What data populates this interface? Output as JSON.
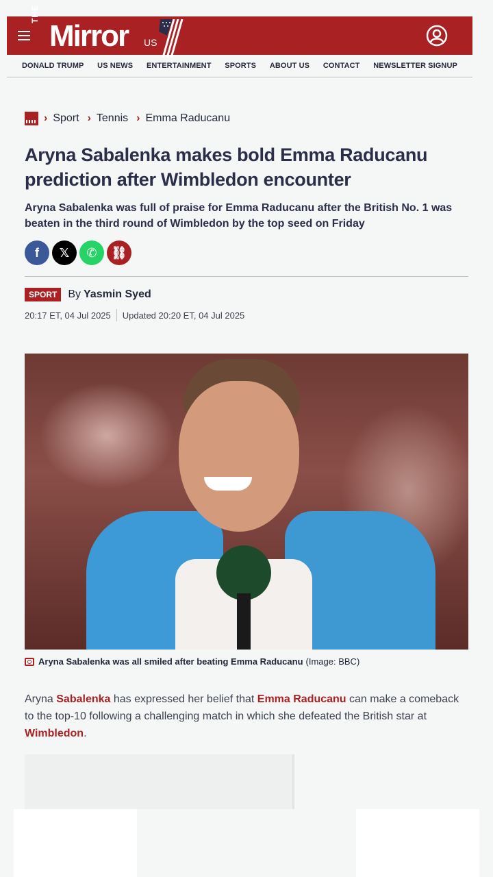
{
  "header": {
    "logo_the": "THE",
    "logo_mirror": "Mirror",
    "logo_us": "US",
    "brand_color": "#aa2124"
  },
  "nav": {
    "items": [
      "DONALD TRUMP",
      "US NEWS",
      "ENTERTAINMENT",
      "SPORTS",
      "ABOUT US",
      "CONTACT",
      "NEWSLETTER SIGNUP"
    ]
  },
  "breadcrumb": {
    "items": [
      "Sport",
      "Tennis",
      "Emma Raducanu"
    ]
  },
  "article": {
    "headline": "Aryna Sabalenka makes bold Emma Raducanu prediction after Wimbledon encounter",
    "standfirst": "Aryna Sabalenka was full of praise for Emma Raducanu after the British No. 1 was beaten in the third round of Wimbledon by the top seed on Friday",
    "section_badge": "SPORT",
    "by_label": "By",
    "author": "Yasmin Syed",
    "published": "20:17 ET, 04 Jul 2025",
    "updated": "Updated 20:20 ET, 04 Jul 2025",
    "image_caption": "Aryna Sabalenka was all smiled after beating Emma Raducanu",
    "image_credit": "(Image: BBC)",
    "body": {
      "p1_a": "Aryna ",
      "p1_link1": "Sabalenka",
      "p1_b": " has expressed her belief that ",
      "p1_link2": "Emma Raducanu",
      "p1_c": " can make a comeback to the top-10 following a challenging match in which she defeated the British star at ",
      "p1_link3": "Wimbledon",
      "p1_d": "."
    }
  },
  "share": {
    "facebook_icon": "f",
    "x_icon": "𝕏",
    "whatsapp_icon": "✆",
    "link_icon": "⛓"
  }
}
